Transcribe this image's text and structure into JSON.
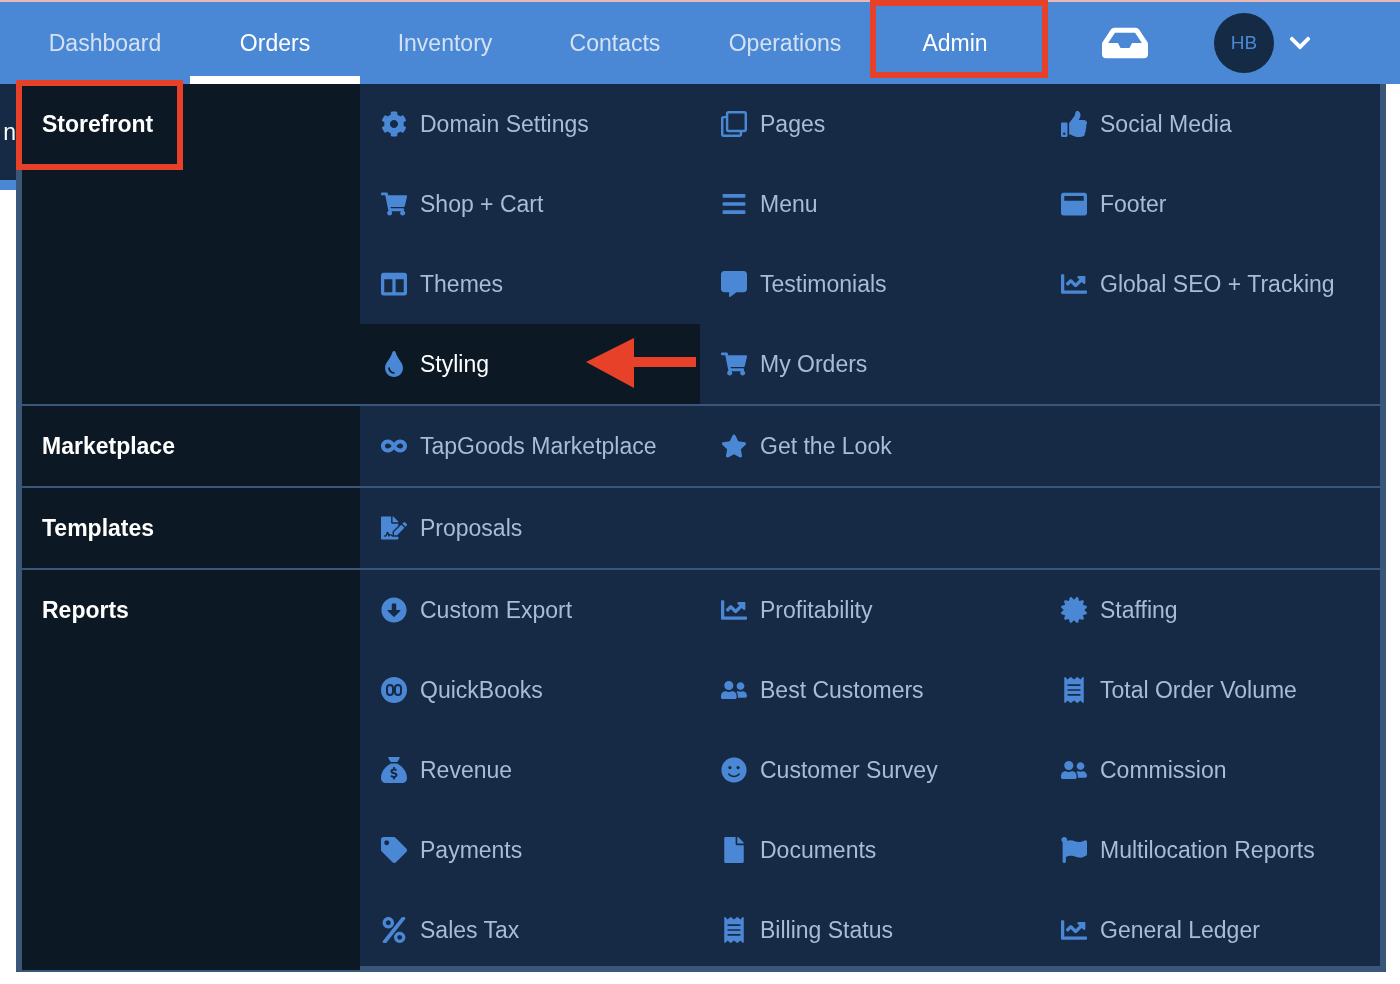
{
  "nav": {
    "tabs": [
      {
        "label": "Dashboard",
        "selected": false,
        "highlighted": false
      },
      {
        "label": "Orders",
        "selected": true,
        "highlighted": false
      },
      {
        "label": "Inventory",
        "selected": false,
        "highlighted": false
      },
      {
        "label": "Contacts",
        "selected": false,
        "highlighted": false
      },
      {
        "label": "Operations",
        "selected": false,
        "highlighted": false
      },
      {
        "label": "Admin",
        "selected": false,
        "highlighted": true
      }
    ],
    "avatar": "HB"
  },
  "background_fragment": "n",
  "menu": {
    "sections": [
      {
        "title": "Storefront",
        "highlighted": true,
        "items": [
          {
            "label": "Domain Settings",
            "selected": false,
            "pointed": false
          },
          {
            "label": "Pages",
            "selected": false,
            "pointed": false
          },
          {
            "label": "Social Media",
            "selected": false,
            "pointed": false
          },
          {
            "label": "Shop + Cart",
            "selected": false,
            "pointed": false
          },
          {
            "label": "Menu",
            "selected": false,
            "pointed": false
          },
          {
            "label": "Footer",
            "selected": false,
            "pointed": false
          },
          {
            "label": "Themes",
            "selected": false,
            "pointed": false
          },
          {
            "label": "Testimonials",
            "selected": false,
            "pointed": false
          },
          {
            "label": "Global SEO + Tracking",
            "selected": false,
            "pointed": false
          },
          {
            "label": "Styling",
            "selected": true,
            "pointed": true
          },
          {
            "label": "My Orders",
            "selected": false,
            "pointed": false
          }
        ]
      },
      {
        "title": "Marketplace",
        "highlighted": false,
        "items": [
          {
            "label": "TapGoods Marketplace",
            "selected": false,
            "pointed": false
          },
          {
            "label": "Get the Look",
            "selected": false,
            "pointed": false
          }
        ]
      },
      {
        "title": "Templates",
        "highlighted": false,
        "items": [
          {
            "label": "Proposals",
            "selected": false,
            "pointed": false
          }
        ]
      },
      {
        "title": "Reports",
        "highlighted": false,
        "items": [
          {
            "label": "Custom Export",
            "selected": false,
            "pointed": false
          },
          {
            "label": "Profitability",
            "selected": false,
            "pointed": false
          },
          {
            "label": "Staffing",
            "selected": false,
            "pointed": false
          },
          {
            "label": "QuickBooks",
            "selected": false,
            "pointed": false
          },
          {
            "label": "Best Customers",
            "selected": false,
            "pointed": false
          },
          {
            "label": "Total Order Volume",
            "selected": false,
            "pointed": false
          },
          {
            "label": "Revenue",
            "selected": false,
            "pointed": false
          },
          {
            "label": "Customer Survey",
            "selected": false,
            "pointed": false
          },
          {
            "label": "Commission",
            "selected": false,
            "pointed": false
          },
          {
            "label": "Payments",
            "selected": false,
            "pointed": false
          },
          {
            "label": "Documents",
            "selected": false,
            "pointed": false
          },
          {
            "label": "Multilocation Reports",
            "selected": false,
            "pointed": false
          },
          {
            "label": "Sales Tax",
            "selected": false,
            "pointed": false
          },
          {
            "label": "Billing Status",
            "selected": false,
            "pointed": false
          },
          {
            "label": "General Ledger",
            "selected": false,
            "pointed": false
          }
        ]
      }
    ]
  }
}
